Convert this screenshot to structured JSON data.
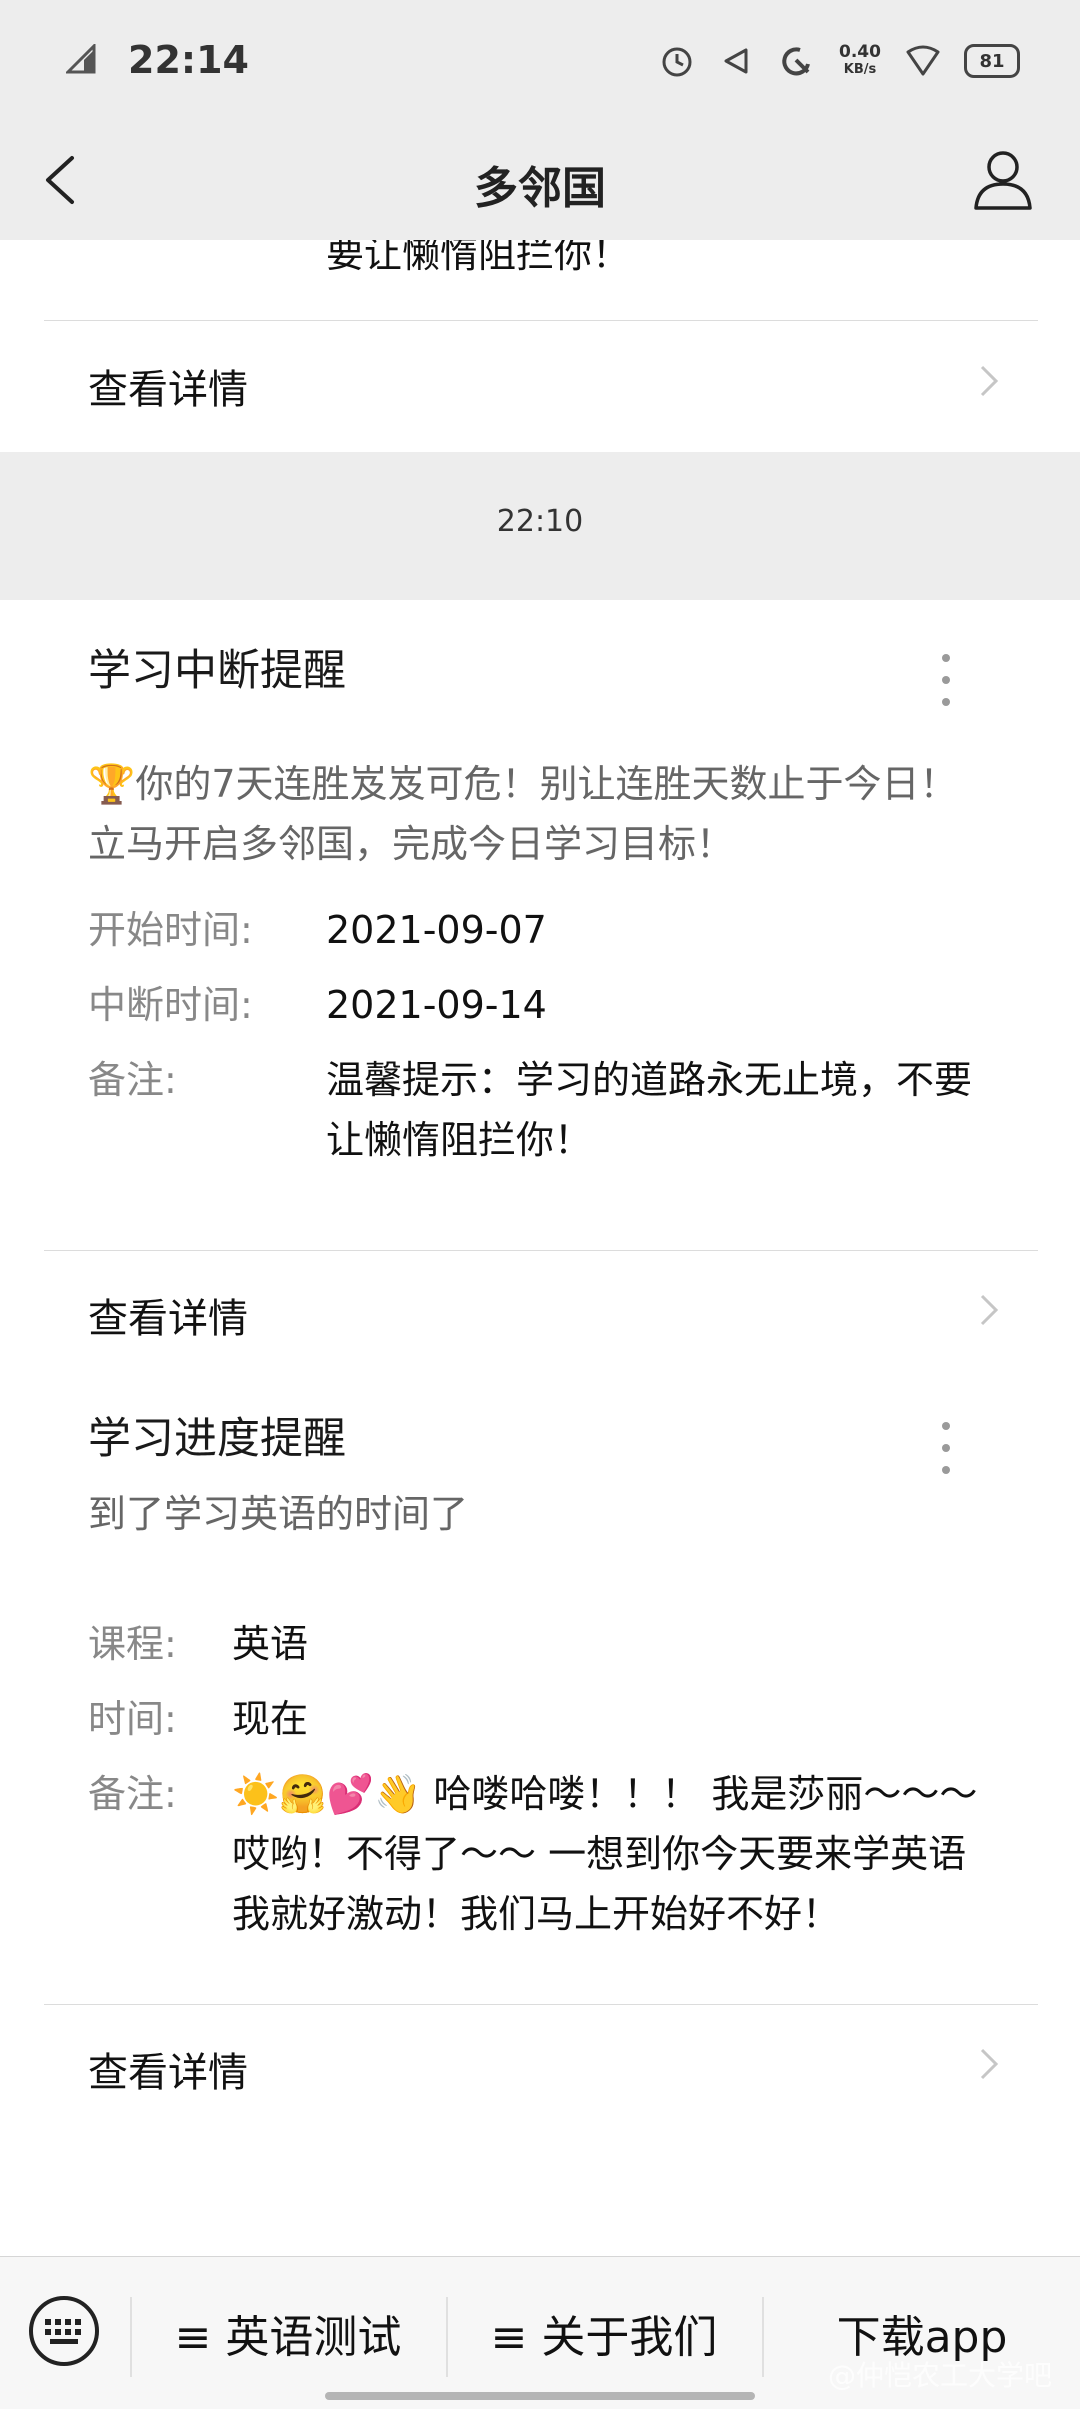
{
  "status_bar": {
    "time": "22:14",
    "speed_value": "0.40",
    "speed_unit": "KB/s",
    "battery": "81"
  },
  "nav": {
    "title": "多邻国",
    "back_icon": "chevron-left-icon",
    "user_icon": "user-icon"
  },
  "top_card": {
    "partial_text": "要让懒惰阻拦你！",
    "detail_label": "查看详情"
  },
  "messages": [
    {
      "timestamp": "22:10",
      "title": "学习中断提醒",
      "description": "🏆你的7天连胜岌岌可危！别让连胜天数止于今日！立马开启多邻国，完成今日学习目标！",
      "fields": [
        {
          "key": "开始时间:",
          "value": "2021-09-07"
        },
        {
          "key": "中断时间:",
          "value": "2021-09-14"
        },
        {
          "key": "备注:",
          "value": "温馨提示：学习的道路永无止境，不要让懒惰阻拦你！"
        }
      ],
      "detail_label": "查看详情"
    },
    {
      "title": "学习进度提醒",
      "description": "到了学习英语的时间了",
      "fields": [
        {
          "key": "课程:",
          "value": "英语"
        },
        {
          "key": "时间:",
          "value": "现在"
        },
        {
          "key": "备注:",
          "value": "☀️🤗💕👋 哈喽哈喽！！！ 我是莎丽～～～ 哎哟！不得了～～ 一想到你今天要来学英语我就好激动！我们马上开始好不好！"
        }
      ],
      "detail_label": "查看详情"
    }
  ],
  "bottom_menu": {
    "keyboard_icon": "keyboard-icon",
    "items": [
      "≡ 英语测试",
      "≡ 关于我们",
      "下载app"
    ]
  },
  "watermark": "@仲恺农工大学吧",
  "colors": {
    "background": "#ededed",
    "card": "#ffffff",
    "highlight_red": "#e23a3a"
  }
}
